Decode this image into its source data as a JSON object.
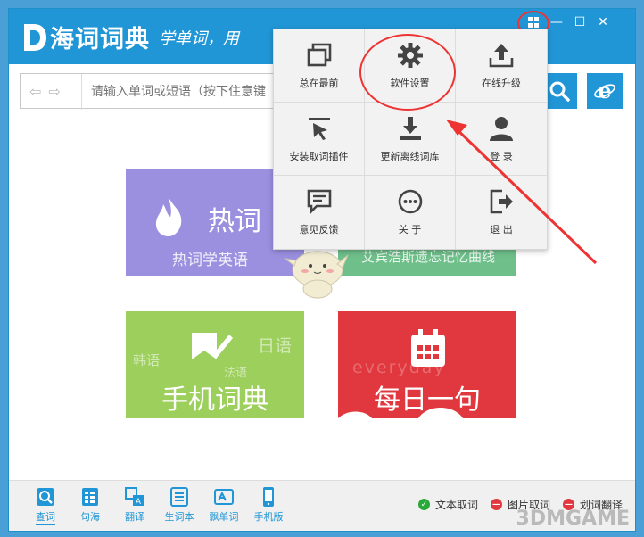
{
  "app": {
    "logo_text": "海词词典",
    "slogan": "学单词，用"
  },
  "window_controls": {
    "menu_icon": "grid-menu-icon",
    "min": "—",
    "max": "☐",
    "close": "✕"
  },
  "search": {
    "placeholder": "请输入单词或短语（按下住意键"
  },
  "tiles": {
    "hot_title": "热词",
    "hot_sub": "热词学英语",
    "curve_sub": "艾宾浩斯遗忘记忆曲线",
    "phone_title": "手机词典",
    "phone_lang1": "韩语",
    "phone_lang2": "日语",
    "phone_lang3": "法语",
    "day_title": "每日一句",
    "day_bg": "everyday"
  },
  "menu": {
    "items": [
      {
        "label": "总在最前",
        "icon": "window-stack-icon"
      },
      {
        "label": "软件设置",
        "icon": "gear-icon"
      },
      {
        "label": "在线升级",
        "icon": "upload-icon"
      },
      {
        "label": "安装取词插件",
        "icon": "cursor-arrow-icon"
      },
      {
        "label": "更新离线词库",
        "icon": "download-icon"
      },
      {
        "label": "登 录",
        "icon": "user-icon"
      },
      {
        "label": "意见反馈",
        "icon": "chat-bubble-icon"
      },
      {
        "label": "关 于",
        "icon": "ellipsis-circle-icon"
      },
      {
        "label": "退 出",
        "icon": "exit-icon"
      }
    ]
  },
  "bottom_nav": [
    {
      "label": "查词",
      "icon": "search-doc-icon"
    },
    {
      "label": "句海",
      "icon": "grid-doc-icon"
    },
    {
      "label": "翻译",
      "icon": "translate-icon"
    },
    {
      "label": "生词本",
      "icon": "notebook-icon"
    },
    {
      "label": "飘单词",
      "icon": "float-word-icon"
    },
    {
      "label": "手机版",
      "icon": "phone-icon"
    }
  ],
  "status": {
    "text_capture": "文本取词",
    "image_capture": "图片取词",
    "select_translate": "划词翻译"
  },
  "watermark": "3DMGAME",
  "colors": {
    "brand": "#2196d6",
    "annotation": "#e33333",
    "ok": "#2aa83a",
    "off": "#e0383e"
  }
}
